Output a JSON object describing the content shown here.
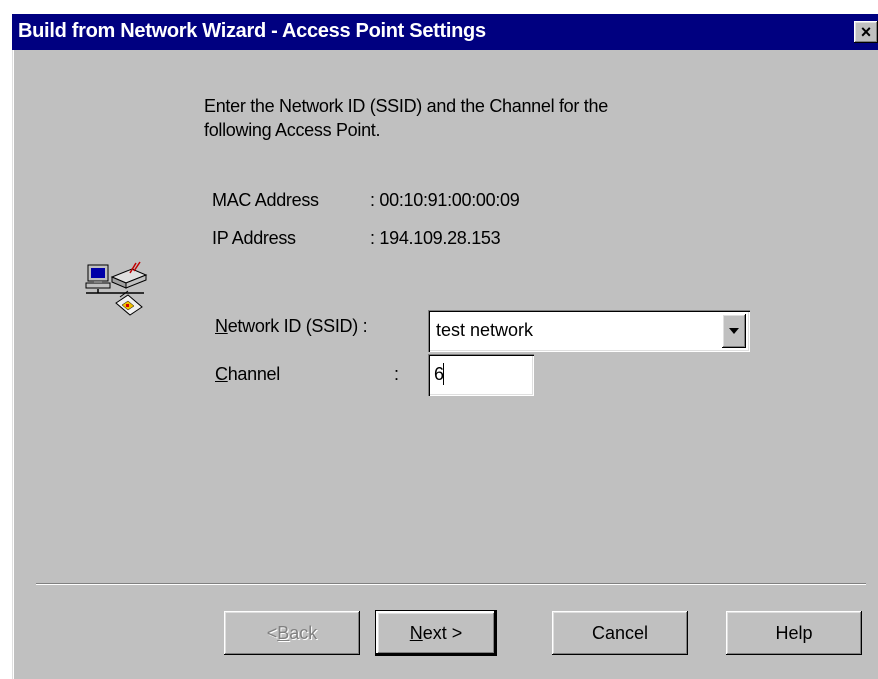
{
  "window": {
    "title": "Build from Network Wizard - Access Point Settings",
    "close_glyph": "×"
  },
  "instructions": {
    "line1": "Enter the Network ID (SSID) and the Channel for the",
    "line2": "following Access Point."
  },
  "info": {
    "mac_label": "MAC Address",
    "mac_value": ": 00:10:91:00:00:09",
    "ip_label": "IP Address",
    "ip_value": ": 194.109.28.153"
  },
  "form": {
    "ssid_label_hotkey": "N",
    "ssid_label_rest": "etwork ID (SSID) :",
    "ssid_value": "test network",
    "channel_label_hotkey": "C",
    "channel_label_rest": "hannel",
    "channel_colon": ":",
    "channel_value": "6"
  },
  "buttons": {
    "back_prefix": "< ",
    "back_hotkey": "B",
    "back_rest": "ack",
    "next_hotkey": "N",
    "next_rest": "ext >",
    "cancel": "Cancel",
    "help": "Help"
  },
  "icons": {
    "wizard": "network-computers-icon",
    "dropdown": "chevron-down-icon",
    "close": "close-icon"
  }
}
